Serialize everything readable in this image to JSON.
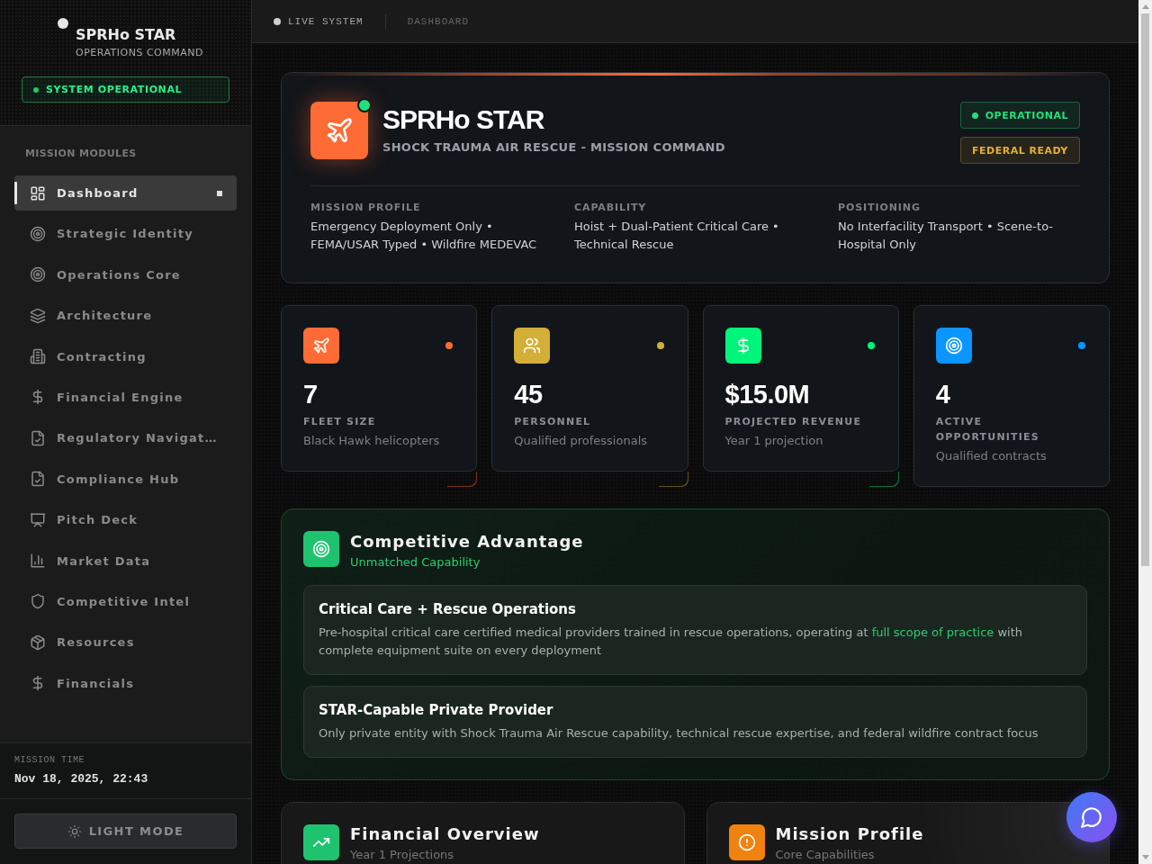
{
  "sidebar": {
    "brand": {
      "title": "SPRHo STAR",
      "subtitle": "OPERATIONS COMMAND"
    },
    "status": "SYSTEM OPERATIONAL",
    "section_label": "MISSION MODULES",
    "items": [
      {
        "label": "Dashboard",
        "selected": true
      },
      {
        "label": "Strategic Identity",
        "selected": false
      },
      {
        "label": "Operations Core",
        "selected": false
      },
      {
        "label": "Architecture",
        "selected": false
      },
      {
        "label": "Contracting",
        "selected": false
      },
      {
        "label": "Financial Engine",
        "selected": false
      },
      {
        "label": "Regulatory Navigat…",
        "selected": false
      },
      {
        "label": "Compliance Hub",
        "selected": false
      },
      {
        "label": "Pitch Deck",
        "selected": false
      },
      {
        "label": "Market Data",
        "selected": false
      },
      {
        "label": "Competitive Intel",
        "selected": false
      },
      {
        "label": "Resources",
        "selected": false
      },
      {
        "label": "Financials",
        "selected": false
      }
    ],
    "mission_time": {
      "label": "MISSION TIME",
      "value": "Nov 18, 2025, 22:43"
    },
    "theme_button": "LIGHT MODE"
  },
  "header": {
    "status": "LIVE SYSTEM",
    "breadcrumb": "DASHBOARD"
  },
  "hero": {
    "title": "SPRHo STAR",
    "subtitle": "SHOCK TRAUMA AIR RESCUE - MISSION COMMAND",
    "badges": [
      {
        "label": "OPERATIONAL",
        "kind": "status",
        "color": "#22e07a"
      },
      {
        "label": "FEDERAL READY",
        "kind": "tag",
        "color": "#e6b030"
      }
    ],
    "details": [
      {
        "label": "MISSION PROFILE",
        "text": "Emergency Deployment Only • FEMA/USAR Typed • Wildfire MEDEVAC"
      },
      {
        "label": "CAPABILITY",
        "text": "Hoist + Dual-Patient Critical Care • Technical Rescue"
      },
      {
        "label": "POSITIONING",
        "text": "No Interfacility Transport • Scene-to-Hospital Only"
      }
    ]
  },
  "stats": [
    {
      "value": "7",
      "label": "FLEET SIZE",
      "description": "Black Hawk helicopters",
      "color": "#ff6b35"
    },
    {
      "value": "45",
      "label": "PERSONNEL",
      "description": "Qualified professionals",
      "color": "#d4af37"
    },
    {
      "value": "$15.0M",
      "label": "PROJECTED REVENUE",
      "description": "Year 1 projection",
      "color": "#00f57a"
    },
    {
      "value": "4",
      "label": "ACTIVE OPPORTUNITIES",
      "description": "Qualified contracts",
      "color": "#0a95ff"
    }
  ],
  "competitive_advantage": {
    "title": "Competitive Advantage",
    "subtitle": "Unmatched Capability",
    "points": [
      {
        "title": "Critical Care + Rescue Operations",
        "description": [
          {
            "text": "Pre-hospital critical care certified medical providers trained in rescue operations, operating at ",
            "highlight": false
          },
          {
            "text": "full scope of practice",
            "highlight": true
          },
          {
            "text": " with complete equipment suite on every deployment",
            "highlight": false
          }
        ]
      },
      {
        "title": "STAR-Capable Private Provider",
        "description": [
          {
            "text": "Only private entity with Shock Trauma Air Rescue capability, technical rescue expertise, and federal wildfire contract focus",
            "highlight": false
          }
        ]
      }
    ]
  },
  "sections": [
    {
      "title": "Financial Overview",
      "subtitle": "Year 1 Projections",
      "color": "#1fc26f"
    },
    {
      "title": "Mission Profile",
      "subtitle": "Core Capabilities",
      "color": "#f0820f"
    }
  ]
}
